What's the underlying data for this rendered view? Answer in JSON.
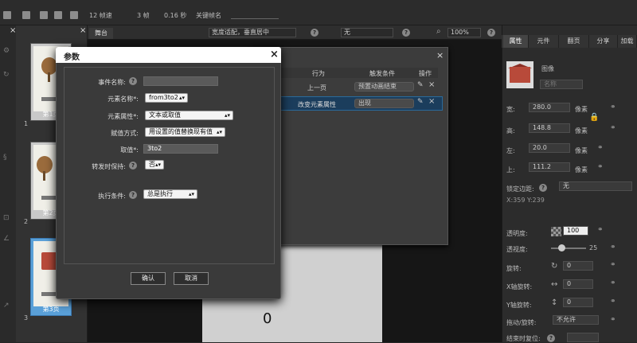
{
  "topbar": {
    "frame_rate": "12 帧速",
    "frame_count": "3 帧",
    "duration": "0.16 秒",
    "keyframe_name": "关键帧名"
  },
  "thumbs": [
    {
      "num": "1",
      "caption": "第1页"
    },
    {
      "num": "2",
      "caption": "第2页"
    },
    {
      "num": "3",
      "caption": "第3页"
    }
  ],
  "stagebar": {
    "tab": "舞台",
    "fit": "宽度适配，垂直居中",
    "none": "无",
    "zoom": "100%"
  },
  "canvas": {
    "number": "0"
  },
  "bgdialog": {
    "headers": [
      "行为",
      "触发条件",
      "操作"
    ],
    "rows": [
      {
        "action": "上一页",
        "trigger": "预置动画结束"
      },
      {
        "action": "改变元素属性",
        "trigger": "出现"
      }
    ]
  },
  "dialog": {
    "title": "参数",
    "fields": [
      {
        "label": "事件名称:",
        "value": ""
      },
      {
        "label": "元素名称*:",
        "value": "from3to2"
      },
      {
        "label": "元素属性*:",
        "value": "文本或取值"
      },
      {
        "label": "赋值方式:",
        "value": "用设置的值替换现有值"
      },
      {
        "label": "取值*:",
        "value": "3to2"
      },
      {
        "label": "转发时保持:",
        "value": "否"
      },
      {
        "label": "执行条件:",
        "value": "总是执行"
      }
    ],
    "ok": "确认",
    "cancel": "取消"
  },
  "rpanel": {
    "tabs": [
      "属性",
      "元件",
      "翻页",
      "分享",
      "加载"
    ],
    "image_label": "图像",
    "name_placeholder": "名称",
    "width_label": "宽:",
    "width": "280.0",
    "height_label": "高:",
    "height": "148.8",
    "left_label": "左:",
    "left": "20.0",
    "top_label": "上:",
    "top": "111.2",
    "unit": "像素",
    "lock_edge": "锁定边距:",
    "lock_value": "无",
    "coords": "X:359    Y:239",
    "opacity_label": "透明度:",
    "opacity": "100",
    "blur_label": "透视度:",
    "blur": "25",
    "rotate_label": "旋转:",
    "rotate": "0",
    "xrot_label": "X轴旋转:",
    "xrot": "0",
    "yrot_label": "Y轴旋转:",
    "yrot": "0",
    "drag_label": "拖动/旋转:",
    "drag": "不允许",
    "end_label": "结束时复位:"
  }
}
